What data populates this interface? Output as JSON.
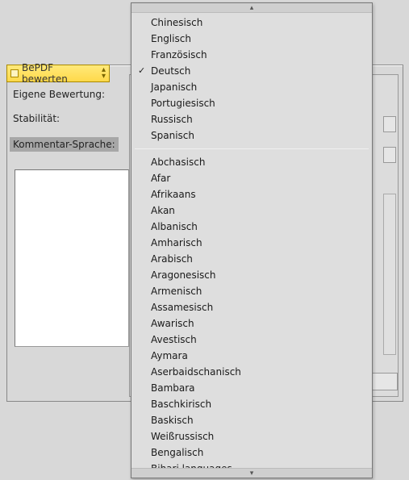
{
  "window": {
    "title": "BePDF bewerten"
  },
  "labels": {
    "rating": "Eigene Bewertung:",
    "stability": "Stabilität:",
    "comment_language": "Kommentar-Sprache:"
  },
  "dropdown": {
    "selected": "Deutsch",
    "group1": [
      "Chinesisch",
      "Englisch",
      "Französisch",
      "Deutsch",
      "Japanisch",
      "Portugiesisch",
      "Russisch",
      "Spanisch"
    ],
    "group2": [
      "Abchasisch",
      "Afar",
      "Afrikaans",
      "Akan",
      "Albanisch",
      "Amharisch",
      "Arabisch",
      "Aragonesisch",
      "Armenisch",
      "Assamesisch",
      "Awarisch",
      "Avestisch",
      "Aymara",
      "Aserbaidschanisch",
      "Bambara",
      "Baschkirisch",
      "Baskisch",
      "Weißrussisch",
      "Bengalisch",
      "Bihari languages"
    ]
  }
}
